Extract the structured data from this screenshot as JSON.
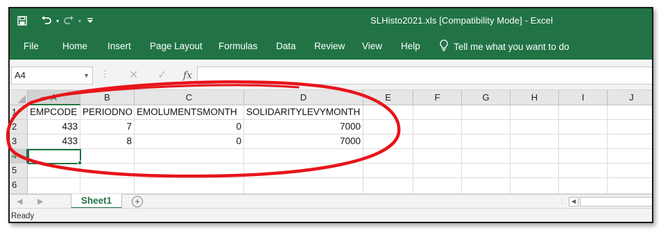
{
  "window": {
    "title": "SLHisto2021.xls  [Compatibility Mode]  -  Excel"
  },
  "quick_access": {
    "save_icon": "save-icon",
    "undo_icon": "undo-icon",
    "redo_icon": "redo-icon",
    "customize_icon": "customize-qat-icon"
  },
  "ribbon": {
    "tabs": [
      "File",
      "Home",
      "Insert",
      "Page Layout",
      "Formulas",
      "Data",
      "Review",
      "View",
      "Help"
    ],
    "tell_me": "Tell me what you want to do",
    "tell_me_icon": "lightbulb-icon"
  },
  "formula_bar": {
    "name_box": "A4",
    "formula": ""
  },
  "grid": {
    "columns": [
      "A",
      "B",
      "C",
      "D",
      "E",
      "F",
      "G",
      "H",
      "I",
      "J"
    ],
    "rows": [
      "1",
      "2",
      "3",
      "4",
      "5",
      "6"
    ],
    "cells": {
      "A1": "EMPCODE",
      "B1": "PERIODNO",
      "C1": "EMOLUMENTSMONTH",
      "D1": "SOLIDARITYLEVYMONTH",
      "A2": "433",
      "B2": "7",
      "C2": "0",
      "D2": "7000",
      "A3": "433",
      "B3": "8",
      "C3": "0",
      "D3": "7000"
    },
    "active_cell": "A4"
  },
  "sheets": {
    "tabs": [
      "Sheet1"
    ],
    "active": "Sheet1"
  },
  "status": {
    "text": "Ready"
  },
  "colors": {
    "accent": "#217346",
    "annotation": "#e8141b"
  }
}
